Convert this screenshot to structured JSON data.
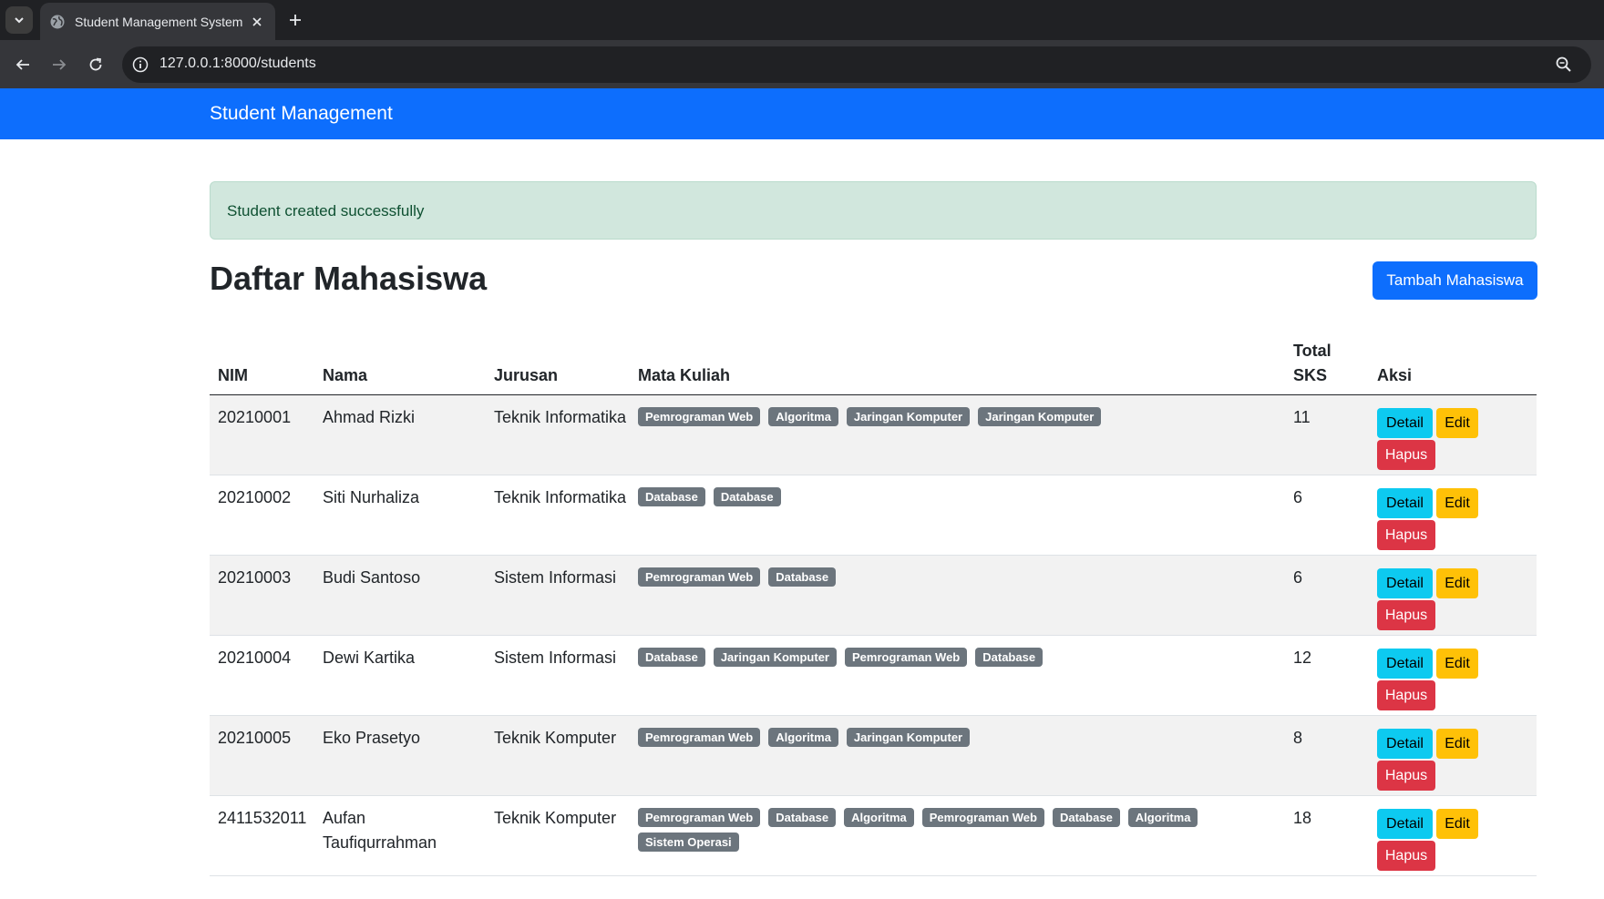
{
  "browser": {
    "tab_title": "Student Management System",
    "url": "127.0.0.1:8000/students"
  },
  "navbar": {
    "brand": "Student Management"
  },
  "alert": {
    "message": "Student created successfully"
  },
  "page": {
    "title": "Daftar Mahasiswa",
    "add_button": "Tambah Mahasiswa"
  },
  "table": {
    "headers": {
      "nim": "NIM",
      "nama": "Nama",
      "jurusan": "Jurusan",
      "mata_kuliah": "Mata Kuliah",
      "total_sks_line1": "Total",
      "total_sks_line2": "SKS",
      "aksi": "Aksi"
    },
    "rows": [
      {
        "nim": "20210001",
        "nama": "Ahmad Rizki",
        "jurusan": "Teknik Informatika",
        "mata_kuliah": [
          "Pemrograman Web",
          "Algoritma",
          "Jaringan Komputer",
          "Jaringan Komputer"
        ],
        "sks": "11"
      },
      {
        "nim": "20210002",
        "nama": "Siti Nurhaliza",
        "jurusan": "Teknik Informatika",
        "mata_kuliah": [
          "Database",
          "Database"
        ],
        "sks": "6"
      },
      {
        "nim": "20210003",
        "nama": "Budi Santoso",
        "jurusan": "Sistem Informasi",
        "mata_kuliah": [
          "Pemrograman Web",
          "Database"
        ],
        "sks": "6"
      },
      {
        "nim": "20210004",
        "nama": "Dewi Kartika",
        "jurusan": "Sistem Informasi",
        "mata_kuliah": [
          "Database",
          "Jaringan Komputer",
          "Pemrograman Web",
          "Database"
        ],
        "sks": "12"
      },
      {
        "nim": "20210005",
        "nama": "Eko Prasetyo",
        "jurusan": "Teknik Komputer",
        "mata_kuliah": [
          "Pemrograman Web",
          "Algoritma",
          "Jaringan Komputer"
        ],
        "sks": "8"
      },
      {
        "nim": "2411532011",
        "nama": "Aufan Taufiqurrahman",
        "jurusan": "Teknik Komputer",
        "mata_kuliah": [
          "Pemrograman Web",
          "Database",
          "Algoritma",
          "Pemrograman Web",
          "Database",
          "Algoritma",
          "Sistem Operasi"
        ],
        "sks": "18"
      }
    ],
    "actions": {
      "detail": "Detail",
      "edit": "Edit",
      "hapus": "Hapus"
    }
  },
  "colors": {
    "primary": "#0d6efd",
    "info": "#0dcaf0",
    "warning": "#ffc107",
    "danger": "#dc3545",
    "badge": "#6c757d",
    "alert_bg": "#d1e7dd"
  }
}
